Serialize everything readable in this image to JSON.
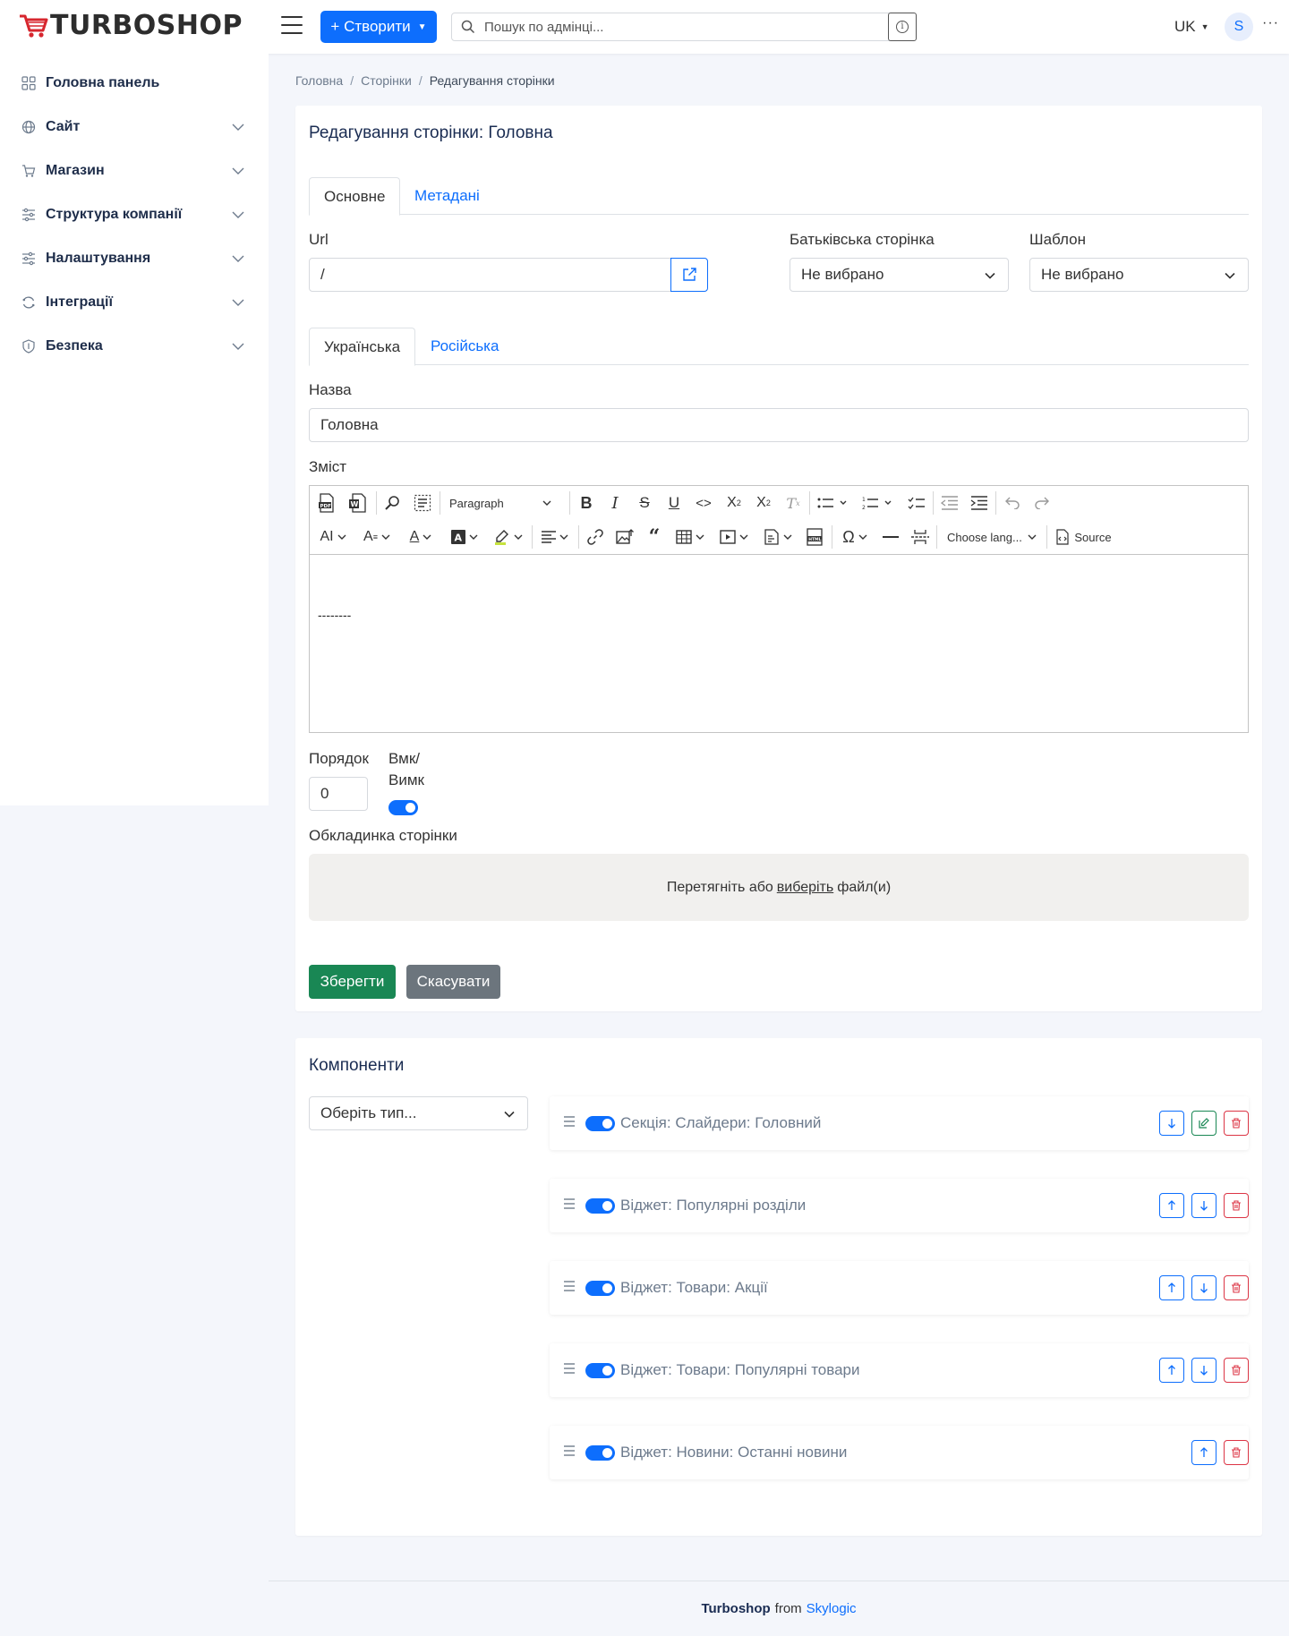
{
  "brand": {
    "name": "TURBOSHOP"
  },
  "topbar": {
    "create_label": "+ Створити",
    "search_placeholder": "Пошук по адмінці...",
    "lang": "UK",
    "avatar": "S"
  },
  "sidebar": {
    "items": [
      {
        "label": "Головна панель"
      },
      {
        "label": "Сайт"
      },
      {
        "label": "Магазин"
      },
      {
        "label": "Структура компанії"
      },
      {
        "label": "Налаштування"
      },
      {
        "label": "Інтеграції"
      },
      {
        "label": "Безпека"
      }
    ]
  },
  "breadcrumb": {
    "home": "Головна",
    "pages": "Сторінки",
    "current": "Редагування сторінки"
  },
  "form": {
    "title": "Редагування сторінки: Головна",
    "tabs": [
      "Основне",
      "Метадані"
    ],
    "url_label": "Url",
    "url_value": "/",
    "parent_label": "Батьківська сторінка",
    "parent_value": "Не вибрано",
    "template_label": "Шаблон",
    "template_value": "Не вибрано",
    "lang_tabs": [
      "Українська",
      "Російська"
    ],
    "name_label": "Назва",
    "name_value": "Головна",
    "content_label": "Зміст",
    "editor": {
      "paragraph": "Paragraph",
      "language": "Choose lang...",
      "source": "Source",
      "content": "--------"
    },
    "order_label": "Порядок",
    "order_value": "0",
    "onoff_label_1": "Вмк/",
    "onoff_label_2": "Вимк",
    "cover_label": "Обкладинка сторінки",
    "dropzone_before": "Перетягніть або",
    "dropzone_link": "виберіть",
    "dropzone_after": "файл(и)",
    "save": "Зберегти",
    "cancel": "Скасувати"
  },
  "components": {
    "title": "Компоненти",
    "type_placeholder": "Оберіть тип...",
    "items": [
      {
        "name": "Секція: Слайдери: Головний"
      },
      {
        "name": "Віджет: Популярні розділи"
      },
      {
        "name": "Віджет: Товари: Акції"
      },
      {
        "name": "Віджет: Товари: Популярні товари"
      },
      {
        "name": "Віджет: Новини: Останні новини"
      }
    ]
  },
  "footer": {
    "brand": "Turboshop",
    "from": "from",
    "company": "Skylogic"
  },
  "colors": {
    "primary": "#0d6efd",
    "success": "#198754",
    "danger": "#dc3545",
    "secondary": "#6c757d",
    "navy": "#1a2c52"
  }
}
